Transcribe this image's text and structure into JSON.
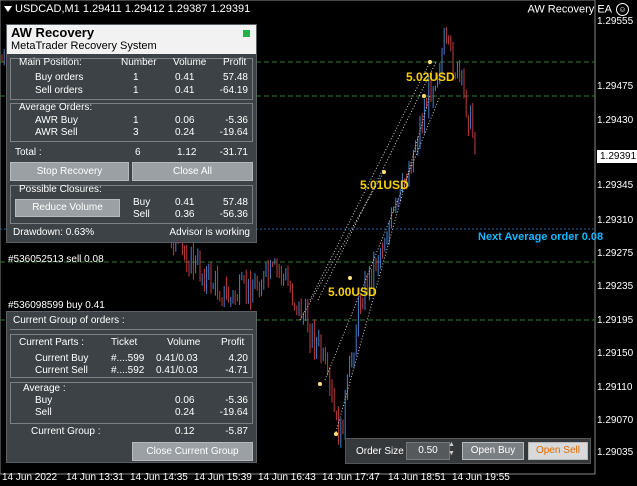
{
  "chart": {
    "symbol_line": "USDCAD,M1  1.29411 1.29412 1.29387 1.29391",
    "ea_name": "AW Recovery EA",
    "prices": [
      "1.29555",
      "1.29475",
      "1.29430",
      "1.29391",
      "1.29345",
      "1.29310",
      "1.29275",
      "1.29235",
      "1.29195",
      "1.29150",
      "1.29110",
      "1.29070",
      "1.29035"
    ],
    "current_price": "1.29391",
    "times": [
      "14 Jun 2022",
      "14 Jun 13:31",
      "14 Jun 14:35",
      "14 Jun 15:39",
      "14 Jun 16:43",
      "14 Jun 17:47",
      "14 Jun 18:51",
      "14 Jun 19:55"
    ],
    "order_labels": {
      "sell": "#536052513 sell 0.08",
      "buy": "#536098599 buy 0.41"
    },
    "tp_labels": [
      "5.02USD",
      "5.01USD",
      "5.00USD"
    ],
    "next_average": "Next Average order 0.08"
  },
  "panel": {
    "title": "AW Recovery",
    "subtitle": "MetaTrader Recovery System",
    "main_position": {
      "heading": "Main Position:",
      "columns": [
        "Number",
        "Volume",
        "Profit"
      ],
      "rows": [
        {
          "label": "Buy orders",
          "number": "1",
          "volume": "0.41",
          "profit": "57.48"
        },
        {
          "label": "Sell orders",
          "number": "1",
          "volume": "0.41",
          "profit": "-64.19"
        }
      ]
    },
    "average_orders": {
      "heading": "Average Orders:",
      "rows": [
        {
          "label": "AWR Buy",
          "number": "1",
          "volume": "0.06",
          "profit": "-5.36"
        },
        {
          "label": "AWR Sell",
          "number": "3",
          "volume": "0.24",
          "profit": "-19.64"
        }
      ]
    },
    "total": {
      "label": "Total :",
      "number": "6",
      "volume": "1.12",
      "profit": "-31.71"
    },
    "buttons": {
      "stop": "Stop Recovery",
      "close_all": "Close All",
      "reduce": "Reduce Volume"
    },
    "possible_closures": {
      "heading": "Possible Closures:",
      "rows": [
        {
          "label": "Buy",
          "volume": "0.41",
          "profit": "57.48"
        },
        {
          "label": "Sell",
          "volume": "0.36",
          "profit": "-56.36"
        }
      ]
    },
    "drawdown": "Drawdown: 0.63%",
    "status": "Advisor is working"
  },
  "group": {
    "title": "Current Group of orders :",
    "parts_heading": "Current Parts :",
    "columns": [
      "Ticket",
      "Volume",
      "Profit"
    ],
    "parts": [
      {
        "label": "Current Buy",
        "ticket": "#....599",
        "volume": "0.41/0.03",
        "profit": "4.20"
      },
      {
        "label": "Current Sell",
        "ticket": "#....592",
        "volume": "0.41/0.03",
        "profit": "-4.71"
      }
    ],
    "average_heading": "Average :",
    "average": [
      {
        "label": "Buy",
        "volume": "0.06",
        "profit": "-5.36"
      },
      {
        "label": "Sell",
        "volume": "0.24",
        "profit": "-19.64"
      }
    ],
    "current_group": {
      "label": "Current Group :",
      "volume": "0.12",
      "profit": "-5.87"
    },
    "close_button": "Close Current Group"
  },
  "order_bar": {
    "label": "Order Size",
    "value": "0.50",
    "open_buy": "Open Buy",
    "open_sell": "Open Sell"
  },
  "colors": {
    "tp": "#f5d000",
    "next_avg": "#19b6ff",
    "level_green": "#2e7d32",
    "bull": "#4a7ec9",
    "bear": "#c23b3b"
  }
}
